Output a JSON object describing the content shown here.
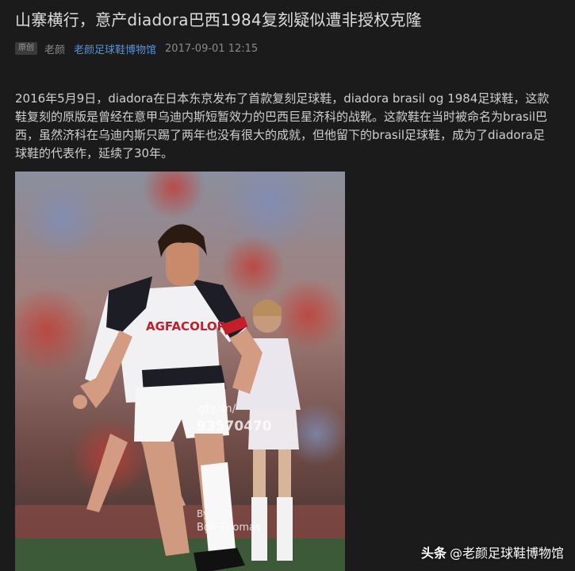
{
  "article": {
    "title": "山寨横行，意产diadora巴西1984复刻疑似遭非授权克隆",
    "tag": "原创",
    "author": "老颜",
    "source": "老颜足球鞋博物馆",
    "time": "2017-09-01 12:15",
    "paragraph": "2016年5月9日，diadora在日本东京发布了首款复刻足球鞋，diadora brasil og 1984足球鞋，这款鞋复刻的原版是曾经在意甲乌迪内斯短暂效力的巴西巨星济科的战靴。这款鞋在当时被命名为brasil巴西，虽然济科在乌迪内斯只踢了两年也没有很大的成就，但他留下的brasil足球鞋，成为了diadora足球鞋的代表作，延续了30年。"
  },
  "photo": {
    "shirt_sponsor": "AGFACOLOR",
    "watermark_url": "gty.im/",
    "watermark_id": "93570470",
    "watermark_by": "By",
    "watermark_name": "Bob Thomas"
  },
  "corner_watermark": {
    "brand": "头条",
    "handle": "@老颜足球鞋博物馆"
  }
}
